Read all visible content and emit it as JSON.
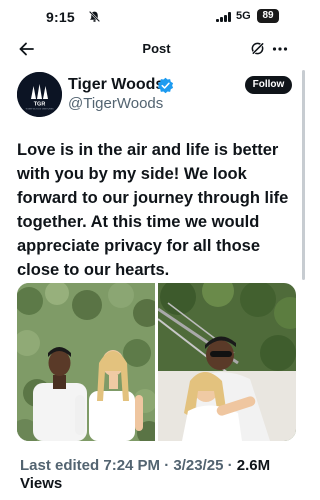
{
  "status_bar": {
    "time": "9:15",
    "network": "5G",
    "battery": "89"
  },
  "nav": {
    "title": "Post"
  },
  "author": {
    "display_name": "Tiger Woods",
    "handle": "@TigerWoods",
    "avatar_text": "TGR",
    "avatar_subtext": "TIGER WOODS VENTURES",
    "verified": true
  },
  "follow_button": {
    "label": "Follow"
  },
  "tweet": {
    "text": "Love is in the air and life is better with you by my side! We look forward to our journey through life together. At this time we would appreciate privacy for all those close to our hearts."
  },
  "meta": {
    "edited_label": "Last edited",
    "time": "7:24 PM",
    "date": "3/23/25",
    "separator": "·",
    "views_count": "2.6M",
    "views_label": "Views"
  },
  "icons": [
    "bell-slash-icon",
    "signal-icon",
    "back-arrow-icon",
    "grok-icon",
    "more-icon",
    "verified-badge-icon"
  ],
  "colors": {
    "text": "#0f1419",
    "secondary_text": "#536471",
    "verified_blue": "#1d9bf0",
    "follow_bg": "#0f1419"
  }
}
